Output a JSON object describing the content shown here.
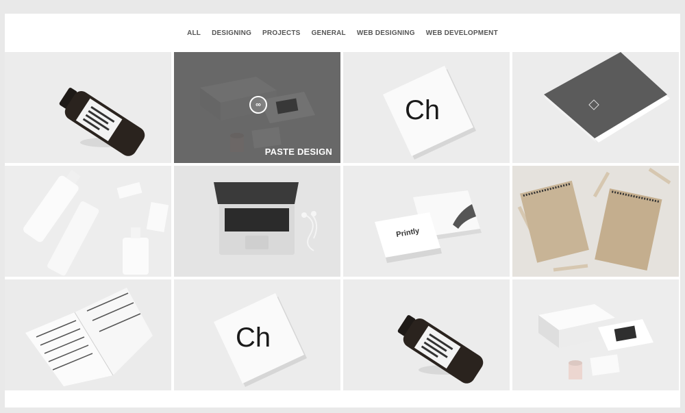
{
  "filters": [
    {
      "label": "ALL"
    },
    {
      "label": "DESIGNING"
    },
    {
      "label": "PROJECTS"
    },
    {
      "label": "GENERAL"
    },
    {
      "label": "WEB DESIGNING"
    },
    {
      "label": "WEB DEVELOPMENT"
    }
  ],
  "tiles": [
    {
      "name": "wine-bottle"
    },
    {
      "name": "stationery-boxes",
      "overlay_title": "PASTE DESIGN",
      "overlay_icon": "link-icon"
    },
    {
      "name": "letterhead-ch"
    },
    {
      "name": "dark-notebook"
    },
    {
      "name": "cosmetic-bottles"
    },
    {
      "name": "laptop-earphones"
    },
    {
      "name": "business-cards"
    },
    {
      "name": "kraft-notepads"
    },
    {
      "name": "open-booklet"
    },
    {
      "name": "letterhead-ch"
    },
    {
      "name": "wine-bottle"
    },
    {
      "name": "stationery-boxes"
    }
  ],
  "mockup_text": {
    "letter_mark": "Ch",
    "card_brand": "Printly"
  }
}
